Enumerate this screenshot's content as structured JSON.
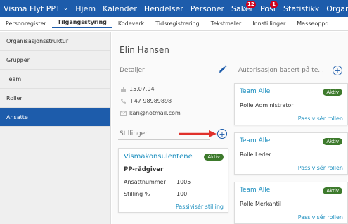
{
  "topnav": {
    "app_name": "Visma Flyt PPT",
    "items": [
      {
        "label": "Hjem"
      },
      {
        "label": "Kalender"
      },
      {
        "label": "Hendelser"
      },
      {
        "label": "Personer"
      },
      {
        "label": "Saker",
        "badge": "12"
      },
      {
        "label": "Post",
        "badge": "1"
      },
      {
        "label": "Statistikk"
      },
      {
        "label": "Organ"
      }
    ]
  },
  "subnav": {
    "items": [
      "Personregister",
      "Tilgangsstyring",
      "Kodeverk",
      "Tidsregistrering",
      "Tekstmaler",
      "Innstillinger",
      "Masseoppd"
    ],
    "active": "Tilgangsstyring"
  },
  "sidebar": {
    "items": [
      "Organisasjonsstruktur",
      "Grupper",
      "Team",
      "Roller",
      "Ansatte"
    ],
    "active": "Ansatte"
  },
  "person": {
    "name": "Elin Hansen",
    "details_title": "Detaljer",
    "birthdate": "15.07.94",
    "phone": "+47 98989898",
    "email": "kari@hotmail.com"
  },
  "positions": {
    "title": "Stillinger",
    "cards": [
      {
        "title": "Vismakonsulentene",
        "status": "Aktiv",
        "role": "PP-rådgiver",
        "employee_no_label": "Ansattnummer",
        "employee_no": "1005",
        "percent_label": "Stilling %",
        "percent": "100",
        "action": "Passivisér stilling"
      }
    ]
  },
  "authorizations": {
    "title": "Autorisasjon basert på te...",
    "cards": [
      {
        "title": "Team Alle",
        "status": "Aktiv",
        "role": "Rolle Administrator",
        "action": "Passivisér rollen"
      },
      {
        "title": "Team Alle",
        "status": "Aktiv",
        "role": "Rolle Leder",
        "action": "Passivisér rollen"
      },
      {
        "title": "Team Alle",
        "status": "Aktiv",
        "role": "Rolle Merkantil",
        "action": "Passivisér rollen"
      }
    ]
  },
  "colors": {
    "primary": "#1d5cab",
    "link": "#1d8fbf",
    "active_tag": "#3d7a2c",
    "badge": "#d0021b",
    "annotation_arrow": "#e0312b"
  }
}
